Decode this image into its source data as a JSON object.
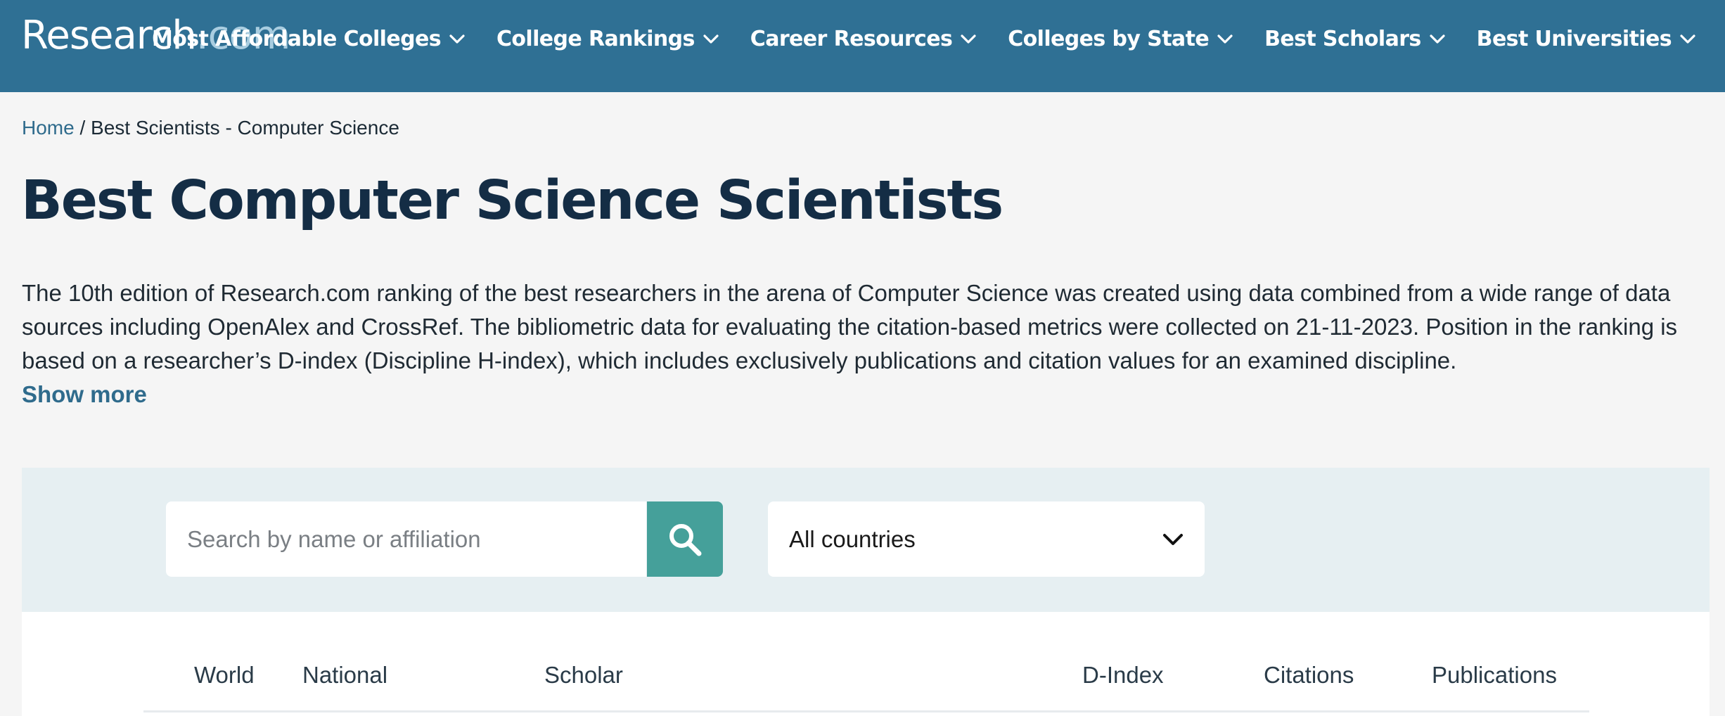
{
  "header": {
    "logo_main": "Research",
    "logo_suffix": ".com",
    "nav": [
      {
        "label": "Most Affordable Colleges",
        "icon": "chevron-down-icon"
      },
      {
        "label": "College Rankings",
        "icon": "chevron-down-icon"
      },
      {
        "label": "Career Resources",
        "icon": "chevron-down-icon"
      },
      {
        "label": "Colleges by State",
        "icon": "chevron-down-icon"
      },
      {
        "label": "Best Scholars",
        "icon": "chevron-down-icon"
      },
      {
        "label": "Best Universities",
        "icon": "chevron-down-icon"
      }
    ]
  },
  "breadcrumb": {
    "home": "Home",
    "separator": " / ",
    "current": "Best Scientists - Computer Science"
  },
  "page": {
    "title": "Best Computer Science Scientists",
    "intro": "The 10th edition of Research.com ranking of the best researchers in the arena of Computer Science was created using data combined from a wide range of data sources including OpenAlex and CrossRef. The bibliometric data for evaluating the citation-based metrics were collected on 21-11-2023. Position in the ranking is based on a researcher’s D-index (Discipline H-index), which includes exclusively publications and citation values for an examined discipline.",
    "show_more": "Show more"
  },
  "filters": {
    "search_placeholder": "Search by name or affiliation",
    "search_value": "",
    "search_icon": "search-icon",
    "country_selected": "All countries",
    "country_icon": "chevron-down-icon"
  },
  "table": {
    "columns": [
      "World",
      "National",
      "Scholar",
      "D-Index",
      "Citations",
      "Publications"
    ]
  },
  "colors": {
    "header_bg": "#2f7094",
    "accent_teal": "#45a09a",
    "link": "#2f6b8c",
    "title": "#142d45"
  }
}
